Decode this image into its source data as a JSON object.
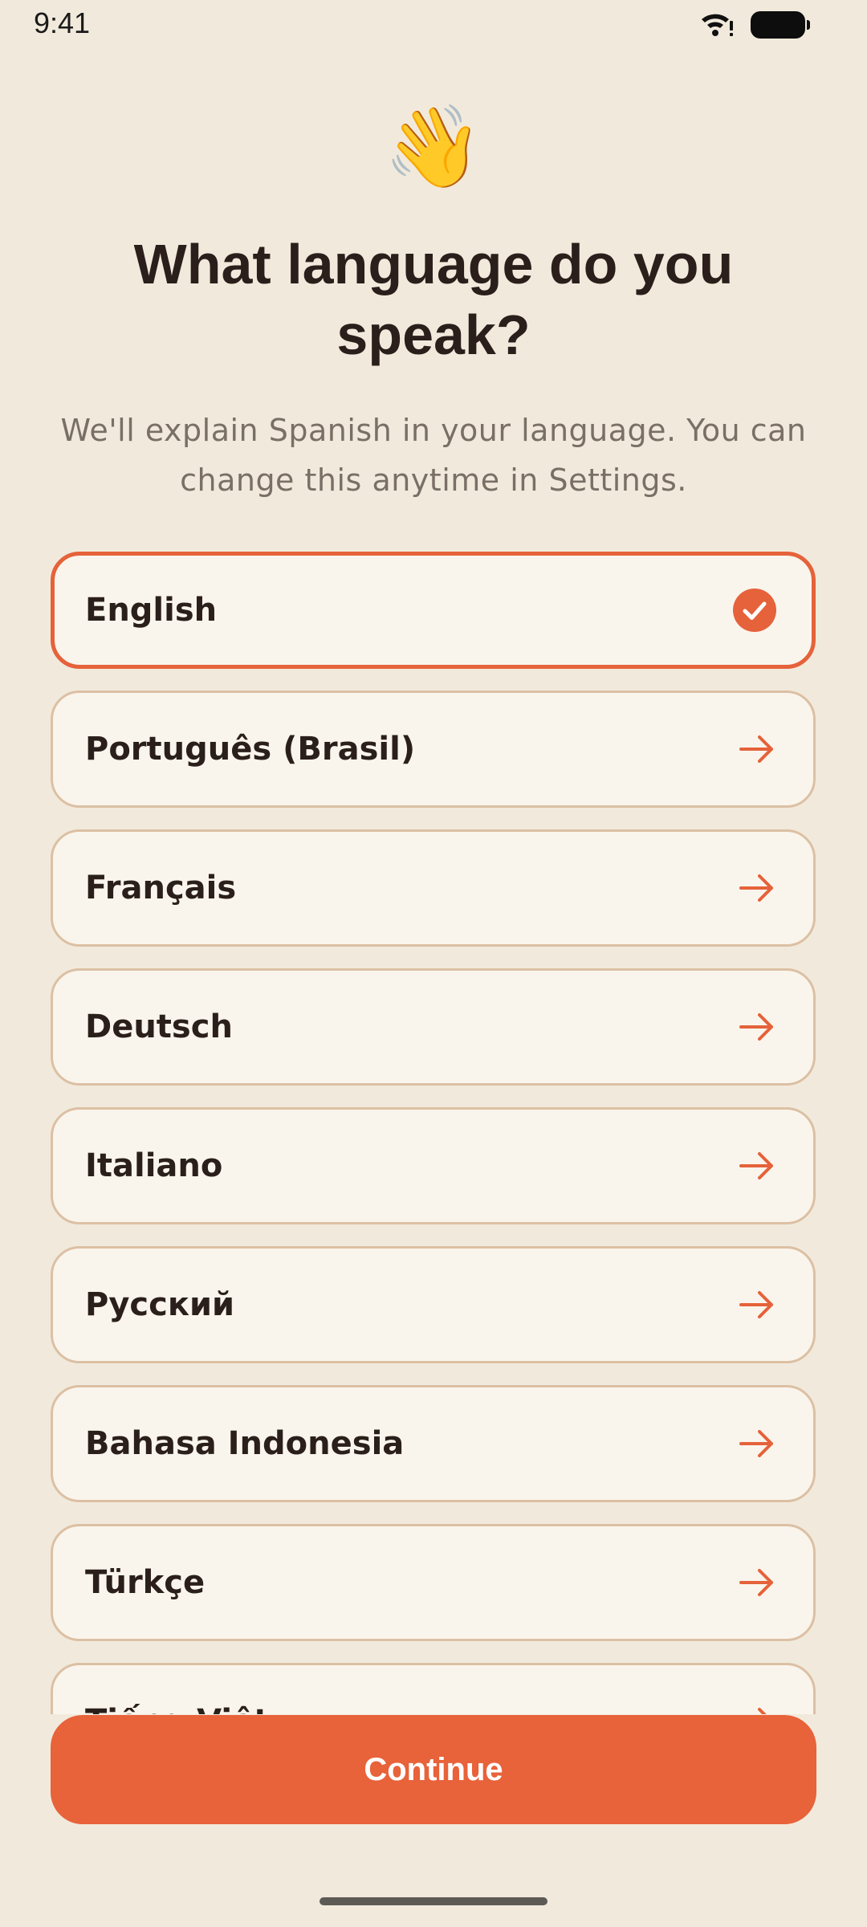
{
  "status_bar": {
    "time": "9:41"
  },
  "header": {
    "emoji": "👋",
    "title": "What language do you speak?",
    "subtitle": "We'll explain Spanish in your language. You can change this anytime in Settings."
  },
  "languages": [
    {
      "label": "English",
      "selected": true
    },
    {
      "label": "Português (Brasil)",
      "selected": false
    },
    {
      "label": "Français",
      "selected": false
    },
    {
      "label": "Deutsch",
      "selected": false
    },
    {
      "label": "Italiano",
      "selected": false
    },
    {
      "label": "Русский",
      "selected": false
    },
    {
      "label": "Bahasa Indonesia",
      "selected": false
    },
    {
      "label": "Türkçe",
      "selected": false
    },
    {
      "label": "Tiếng Việt",
      "selected": false
    }
  ],
  "footer": {
    "continue_label": "Continue"
  },
  "colors": {
    "accent": "#e8623a",
    "background": "#f1eadc",
    "card": "#faf5ec",
    "card_border": "#dcc0a4",
    "text": "#2a1f1b",
    "muted": "#7a6f66"
  },
  "icons": {
    "selected": "check-circle-icon",
    "unselected": "arrow-right-icon"
  }
}
